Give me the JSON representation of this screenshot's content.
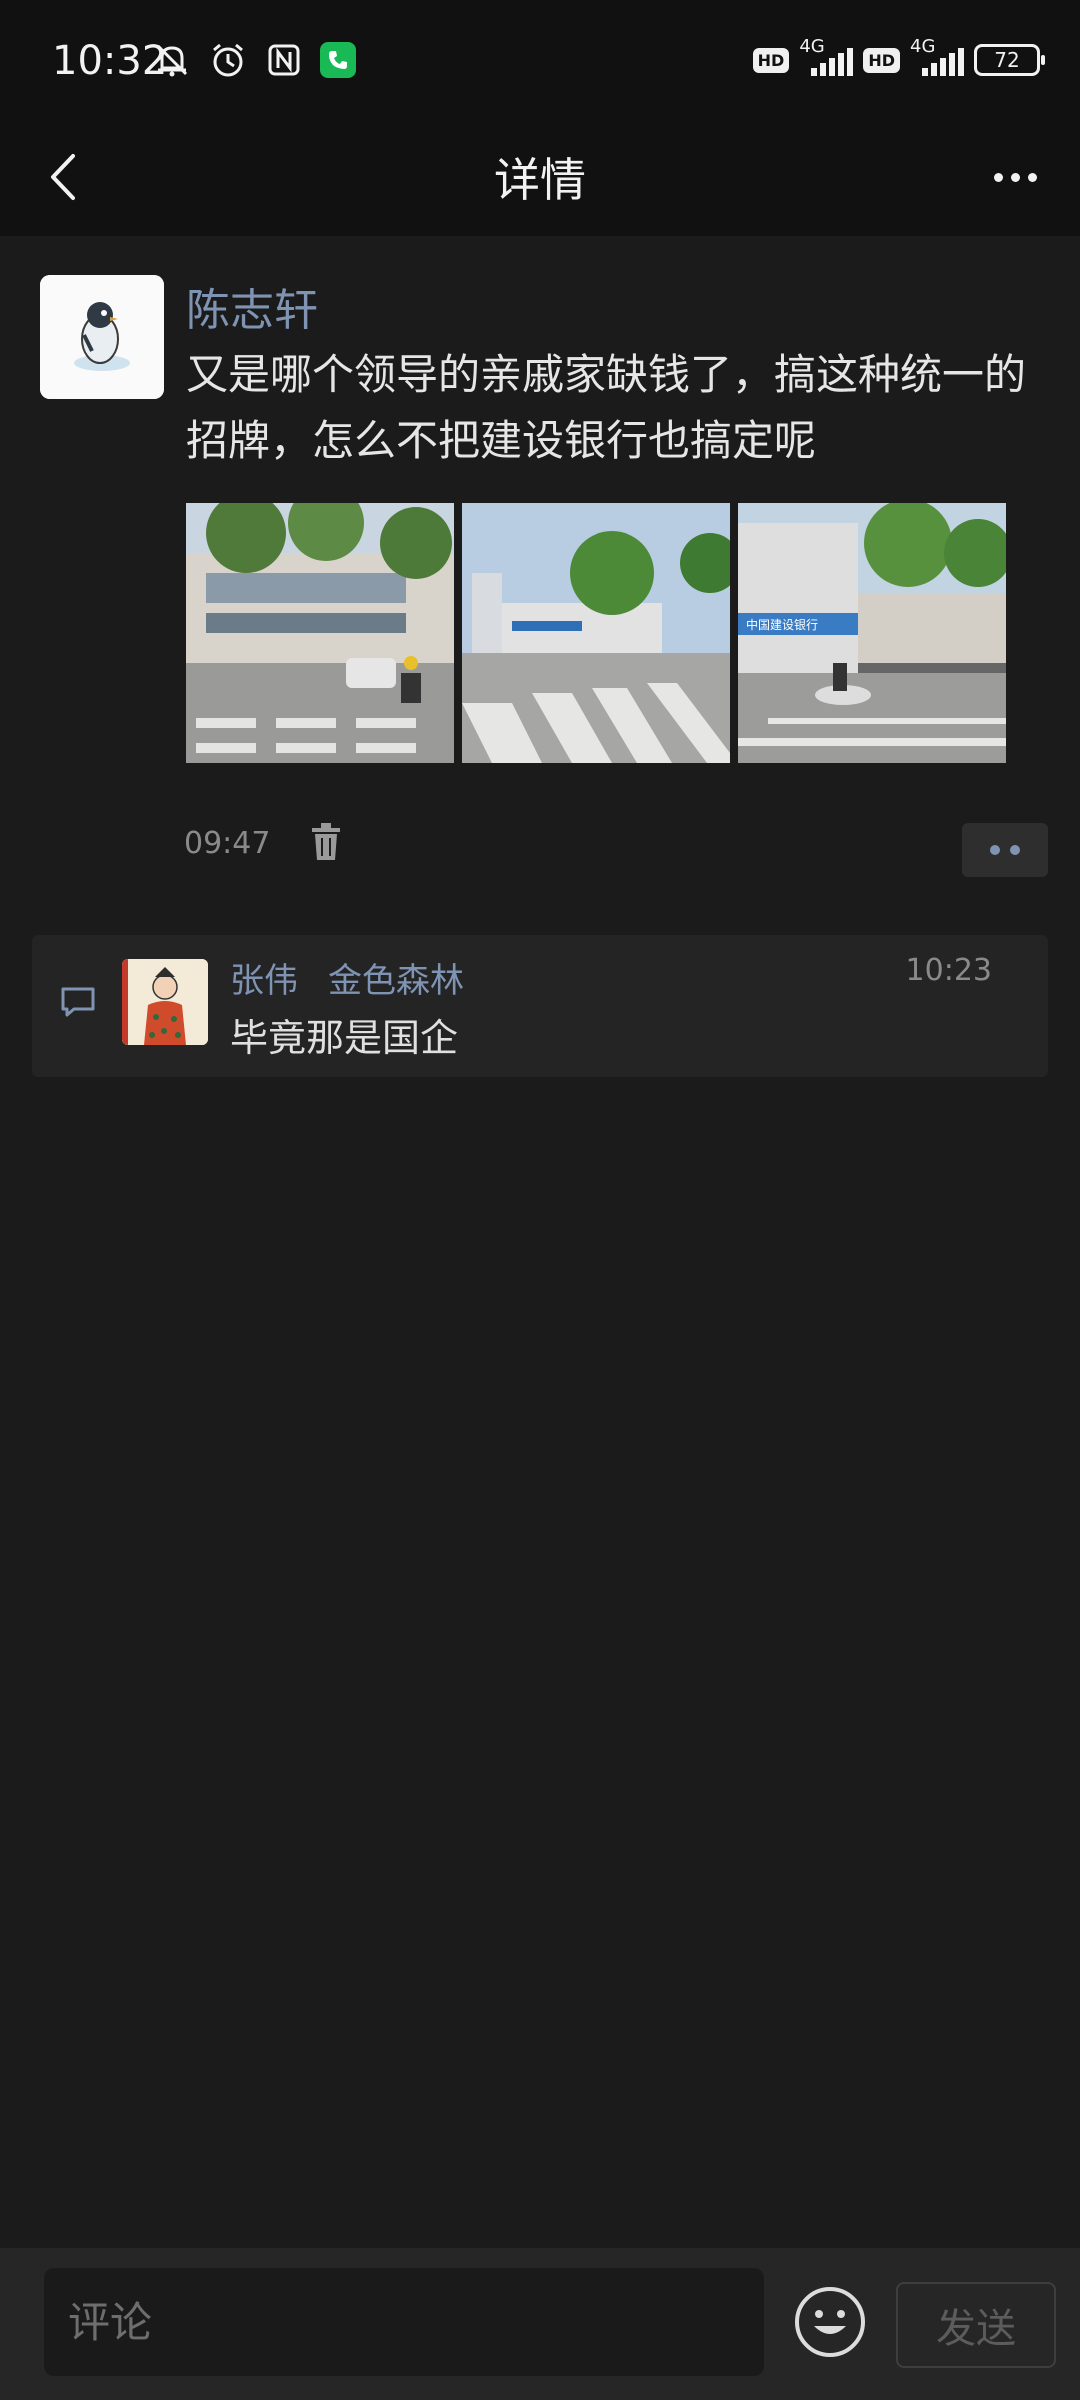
{
  "status_bar": {
    "time": "10:32",
    "left_icons": [
      "mute-bell-icon",
      "alarm-icon",
      "nfc-icon",
      "phone-call-icon"
    ],
    "network": [
      {
        "badge": "HD",
        "type": "4G"
      },
      {
        "badge": "HD",
        "type": "4G"
      }
    ],
    "battery": "72"
  },
  "header": {
    "title": "详情",
    "back_icon": "chevron-left-icon",
    "more_icon": "more-dots-icon"
  },
  "post": {
    "author": "陈志轩",
    "text": "又是哪个领导的亲戚家缺钱了，搞这种统一的招牌，怎么不把建设银行也搞定呢",
    "photos": [
      {
        "sign": ""
      },
      {
        "sign": "中国建设银行"
      },
      {
        "sign": "中国建设银行"
      }
    ],
    "time": "09:47",
    "delete_icon": "trash-icon",
    "action_icon": "like-comment-dots-icon"
  },
  "comments": [
    {
      "names": [
        "张伟",
        "金色森林"
      ],
      "time": "10:23",
      "text": "毕竟那是国企"
    }
  ],
  "bottom_bar": {
    "placeholder": "评论",
    "send_label": "发送",
    "emoji_icon": "smiley-icon"
  },
  "colors": {
    "background": "#1b1b1b",
    "bar": "#111111",
    "name_link": "#7f93b3",
    "call_badge": "#19b956"
  }
}
